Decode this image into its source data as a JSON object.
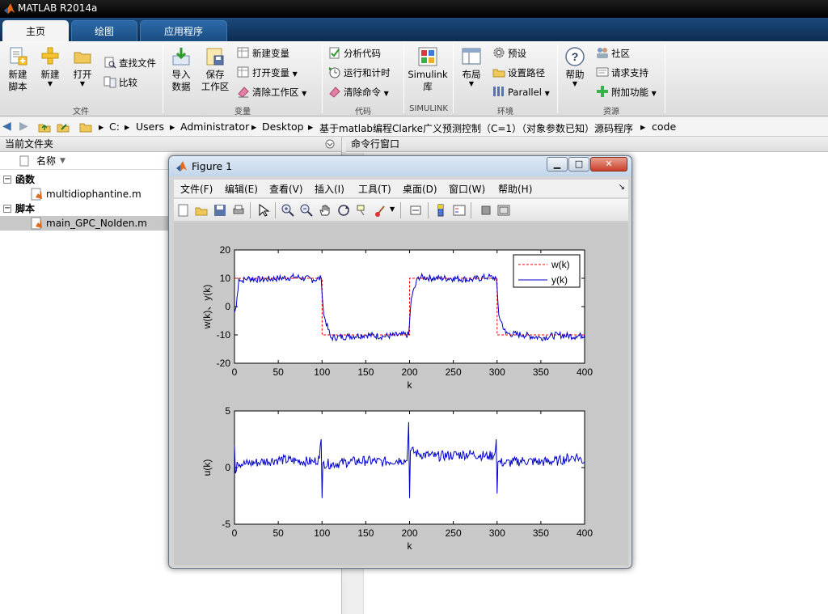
{
  "window": {
    "title": "MATLAB R2014a"
  },
  "tabs": [
    {
      "label": "主页",
      "active": true
    },
    {
      "label": "绘图",
      "active": false
    },
    {
      "label": "应用程序",
      "active": false
    }
  ],
  "ribbon": {
    "file": {
      "new_script": "新建\n脚本",
      "new": "新建",
      "open": "打开",
      "find_files": "查找文件",
      "compare": "比较",
      "group": "文件"
    },
    "variable": {
      "import": "导入\n数据",
      "save_ws": "保存\n工作区",
      "new_var": "新建变量",
      "open_var": "打开变量",
      "clear_ws": "清除工作区",
      "group": "变量"
    },
    "code": {
      "analyze": "分析代码",
      "run_time": "运行和计时",
      "clear_cmd": "清除命令",
      "group": "代码"
    },
    "simulink": {
      "label": "Simulink\n库",
      "group": "SIMULINK"
    },
    "env": {
      "layout": "布局",
      "prefs": "预设",
      "set_path": "设置路径",
      "parallel": "Parallel",
      "group": "环境"
    },
    "resources": {
      "help": "帮助",
      "community": "社区",
      "support": "请求支持",
      "addons": "附加功能",
      "group": "资源"
    }
  },
  "address": {
    "segments": [
      "C:",
      "Users",
      "Administrator",
      "Desktop",
      "基于matlab编程Clarke广义预测控制（C=1）（对象参数已知）源码程序",
      "code"
    ]
  },
  "file_panel": {
    "title": "当前文件夹",
    "column": "名称",
    "groups": [
      {
        "label": "函数",
        "files": [
          "multidiophantine.m"
        ]
      },
      {
        "label": "脚本",
        "files": [
          "main_GPC_NoIden.m"
        ]
      }
    ]
  },
  "command_panel": {
    "title": "命令行窗口"
  },
  "figure": {
    "title": "Figure 1",
    "menus": [
      "文件(F)",
      "编辑(E)",
      "查看(V)",
      "插入(I)",
      "工具(T)",
      "桌面(D)",
      "窗口(W)",
      "帮助(H)"
    ],
    "colors": {
      "y": "#0000cc",
      "w": "#ff0000"
    }
  },
  "chart_data": [
    {
      "type": "line",
      "xlabel": "k",
      "ylabel": "w(k)、y(k)",
      "xlim": [
        0,
        400
      ],
      "ylim": [
        -20,
        20
      ],
      "xticks": [
        0,
        50,
        100,
        150,
        200,
        250,
        300,
        350,
        400
      ],
      "yticks": [
        -20,
        -10,
        0,
        10,
        20
      ],
      "legend_position": "top-right",
      "grid": false,
      "series": [
        {
          "name": "w(k)",
          "style": "dashed",
          "color": "#ff0000",
          "x": [
            0,
            100,
            100,
            200,
            200,
            300,
            300,
            400
          ],
          "y": [
            10,
            10,
            -10,
            -10,
            10,
            10,
            -10,
            -10
          ]
        },
        {
          "name": "y(k)",
          "style": "solid",
          "color": "#0000cc",
          "x": [
            0,
            2,
            5,
            8,
            15,
            30,
            50,
            70,
            90,
            99,
            102,
            110,
            130,
            150,
            170,
            190,
            199,
            202,
            210,
            230,
            250,
            270,
            290,
            299,
            302,
            310,
            330,
            350,
            370,
            390,
            400
          ],
          "y": [
            -2,
            0,
            10,
            9,
            10,
            9.5,
            10,
            10.5,
            9.5,
            10,
            -3,
            -11,
            -10.5,
            -10,
            -10.5,
            -10,
            -10,
            3,
            10.5,
            10,
            10,
            9.5,
            10.5,
            10,
            -3,
            -9.5,
            -10,
            -11,
            -10,
            -10.5,
            -10
          ]
        }
      ]
    },
    {
      "type": "line",
      "xlabel": "k",
      "ylabel": "u(k)",
      "xlim": [
        0,
        400
      ],
      "ylim": [
        -5,
        5
      ],
      "xticks": [
        0,
        50,
        100,
        150,
        200,
        250,
        300,
        350,
        400
      ],
      "yticks": [
        -5,
        0,
        5
      ],
      "grid": false,
      "series": [
        {
          "name": "",
          "style": "solid",
          "color": "#0000cc",
          "x": [
            0,
            1,
            3,
            10,
            30,
            50,
            70,
            90,
            97,
            99,
            100,
            101,
            110,
            130,
            150,
            170,
            190,
            197,
            199,
            200,
            201,
            210,
            230,
            250,
            270,
            290,
            297,
            299,
            300,
            301,
            310,
            330,
            350,
            370,
            390,
            400
          ],
          "y": [
            2,
            -0.5,
            0.5,
            0.3,
            0.5,
            0.7,
            0.6,
            0.5,
            0.8,
            2.5,
            -2.7,
            0.4,
            0.3,
            0.5,
            0.6,
            0.5,
            0.7,
            0.6,
            4,
            -2.7,
            1.5,
            1.2,
            1.0,
            1.1,
            1.2,
            1.0,
            1.1,
            2.5,
            -2.3,
            0.5,
            0.4,
            0.6,
            0.5,
            0.6,
            1.0,
            0.5
          ]
        }
      ]
    }
  ]
}
